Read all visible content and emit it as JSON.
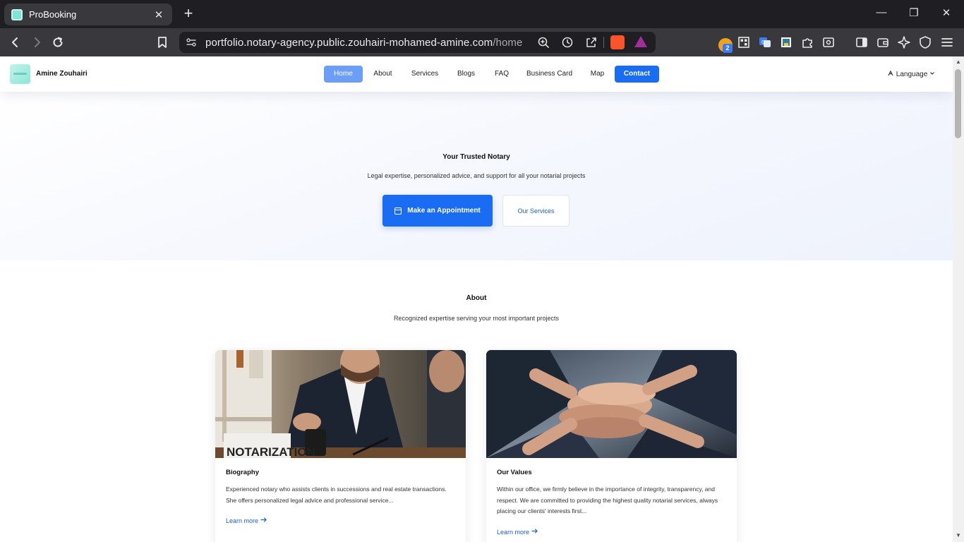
{
  "browser": {
    "tab_title": "ProBooking",
    "tab_close": "✕",
    "new_tab": "+",
    "url_host": "portfolio.notary-agency.public.zouhairi-mohamed-amine.com",
    "url_path": "/home",
    "extension_badge_count": "2",
    "window_controls": {
      "minimize": "—",
      "restore": "❐",
      "close": "✕"
    },
    "icons": {
      "back": "back-icon",
      "forward": "forward-icon",
      "reload": "reload-icon",
      "bookmark": "bookmark-icon",
      "zoom": "zoom-icon",
      "history": "history-icon",
      "share": "share-icon",
      "brave": "brave-shields-icon",
      "rewards": "brave-rewards-icon"
    }
  },
  "nav": {
    "brand": "Amine Zouhairi",
    "items": [
      {
        "label": "Home",
        "active": true
      },
      {
        "label": "About"
      },
      {
        "label": "Services"
      },
      {
        "label": "Blogs"
      },
      {
        "label": "FAQ"
      },
      {
        "label": "Business Card"
      },
      {
        "label": "Map"
      },
      {
        "label": "Contact",
        "style": "primary"
      }
    ],
    "language": "Language"
  },
  "hero": {
    "title": "Your Trusted Notary",
    "subtitle": "Legal expertise, personalized advice, and support for all your notarial projects",
    "primary_button": "Make an Appointment",
    "secondary_button": "Our Services"
  },
  "about": {
    "title": "About",
    "subtitle": "Recognized expertise serving your most important projects",
    "cards": [
      {
        "title": "Biography",
        "image_label": "NOTARIZATION",
        "text": "Experienced notary who assists clients in successions and real estate transactions. She offers personalized legal advice and professional service...",
        "link": "Learn more"
      },
      {
        "title": "Our Values",
        "text": "Within our office, we firmly believe in the importance of integrity, transparency, and respect. We are committed to providing the highest quality notarial services, always placing our clients' interests first...",
        "link": "Learn more"
      }
    ]
  },
  "colors": {
    "primary": "#1a6cf2",
    "nav_active": "#6d9ef7",
    "link": "#1a5fd9",
    "browser_dark": "#1f1f23",
    "browser_toolbar": "#38383d"
  }
}
